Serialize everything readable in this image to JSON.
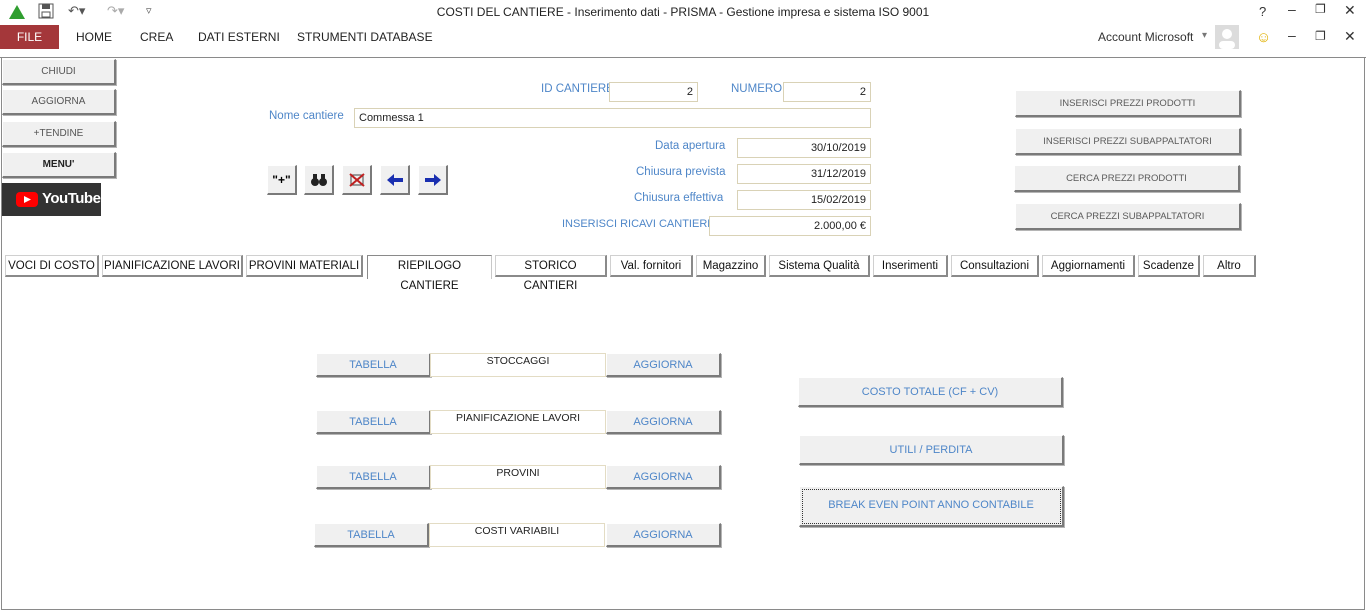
{
  "window": {
    "title": "COSTI DEL CANTIERE - Inserimento dati - PRISMA - Gestione impresa e sistema ISO 9001",
    "help": "?",
    "account": "Account Microsoft",
    "account_caret": "▾"
  },
  "ribbon": {
    "file": "FILE",
    "tabs": [
      "HOME",
      "CREA",
      "DATI ESTERNI",
      "STRUMENTI DATABASE"
    ]
  },
  "left_buttons": [
    "CHIUDI",
    "AGGIORNA",
    "+TENDINE",
    "MENU'"
  ],
  "youtube": {
    "label": "YouTube"
  },
  "header_fields": {
    "id_label": "ID CANTIERE",
    "id_value": "2",
    "numero_label": "NUMERO",
    "numero_value": "2",
    "nome_label": "Nome cantiere",
    "nome_value": "Commessa 1",
    "apertura_label": "Data apertura",
    "apertura_value": "30/10/2019",
    "prevista_label": "Chiusura prevista",
    "prevista_value": "31/12/2019",
    "effettiva_label": "Chiusura effettiva",
    "effettiva_value": "15/02/2019",
    "ricavi_label": "INSERISCI RICAVI CANTIERE",
    "ricavi_value": "2.000,00 €"
  },
  "toolbar": {
    "new_label": "\"+\""
  },
  "right_buttons": [
    "INSERISCI PREZZI PRODOTTI",
    "INSERISCI PREZZI SUBAPPALTATORI",
    "CERCA PREZZI PRODOTTI",
    "CERCA PREZZI SUBAPPALTATORI"
  ],
  "tabs": [
    "VOCI DI COSTO",
    "PIANIFICAZIONE LAVORI",
    "PROVINI MATERIALI",
    "RIEPILOGO CANTIERE",
    "STORICO CANTIERI",
    "Val. fornitori",
    "Magazzino",
    "Sistema Qualità",
    "Inserimenti",
    "Consultazioni",
    "Aggiornamenti",
    "Scadenze",
    "Altro"
  ],
  "active_tab": "RIEPILOGO CANTIERE",
  "summary_rows": [
    {
      "left": "TABELLA",
      "middle": "STOCCAGGI",
      "right": "AGGIORNA"
    },
    {
      "left": "TABELLA",
      "middle": "PIANIFICAZIONE LAVORI",
      "right": "AGGIORNA"
    },
    {
      "left": "TABELLA",
      "middle": "PROVINI",
      "right": "AGGIORNA"
    },
    {
      "left": "TABELLA",
      "middle": "COSTI VARIABILI",
      "right": "AGGIORNA"
    }
  ],
  "analysis_buttons": [
    "COSTO TOTALE (CF + CV)",
    "UTILI / PERDITA",
    "BREAK EVEN POINT ANNO CONTABILE"
  ],
  "colors": {
    "file_tab": "#a4373a",
    "label_blue": "#4e86c8",
    "access_green": "#2f9e2f"
  }
}
